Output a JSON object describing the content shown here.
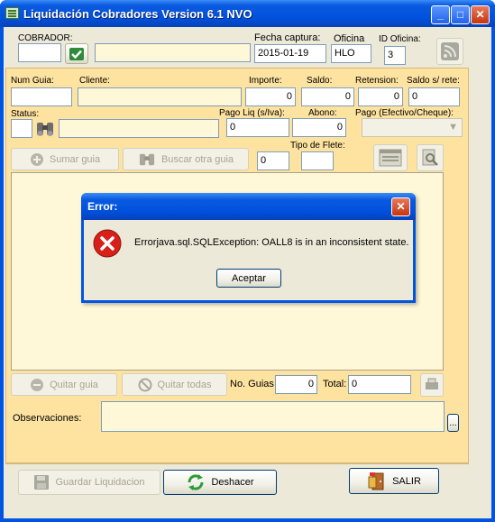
{
  "window": {
    "title": "Liquidación Cobradores Version 6.1 NVO",
    "minimize_glyph": "_",
    "maximize_glyph": "□",
    "close_glyph": "✕"
  },
  "header": {
    "cobrador_label": "COBRADOR:",
    "cobrador_code": "",
    "cobrador_name": "",
    "fecha_label": "Fecha captura:",
    "fecha_value": "2015-01-19",
    "oficina_label": "Oficina",
    "oficina_value": "HLO",
    "id_oficina_label": "ID Oficina:",
    "id_oficina_value": "3"
  },
  "guia": {
    "num_guia_label": "Num Guia:",
    "num_guia_value": "",
    "cliente_label": "Cliente:",
    "cliente_value": "",
    "importe_label": "Importe:",
    "importe_value": "0",
    "saldo_label": "Saldo:",
    "saldo_value": "0",
    "retension_label": "Retension:",
    "retension_value": "0",
    "saldo_rete_label": "Saldo s/ rete:",
    "saldo_rete_value": "0",
    "status_label": "Status:",
    "status_code": "",
    "status_desc": "",
    "pago_liq_label": "Pago Liq (s/Iva):",
    "pago_liq_value": "0",
    "abono_label": "Abono:",
    "abono_value": "0",
    "pago_tipo_label": "Pago (Efectivo/Cheque):",
    "pago_tipo_value": "",
    "tipo_flete_label": "Tipo de Flete:",
    "tipo_flete_value": "",
    "count_value": "0",
    "sumar_label": "Sumar guia",
    "buscar_label": "Buscar otra guia"
  },
  "footer": {
    "quitar_label": "Quitar guia",
    "quitar_todas_label": "Quitar todas",
    "no_guias_label": "No. Guias",
    "no_guias_value": "0",
    "total_label": "Total:",
    "total_value": "0",
    "observaciones_label": "Observaciones:",
    "observaciones_value": "",
    "obs_more_label": "...",
    "guardar_label": "Guardar Liquidacion",
    "deshacer_label": "Deshacer",
    "salir_label": "SALIR"
  },
  "dialog": {
    "title": "Error:",
    "message": "Errorjava.sql.SQLException: OALL8 is in an inconsistent state.",
    "accept_label": "Aceptar",
    "close_glyph": "✕",
    "icon": "error-icon"
  },
  "colors": {
    "panel": "#fde2a0",
    "titlebar": "#0054e3",
    "error_red": "#d8201a"
  }
}
